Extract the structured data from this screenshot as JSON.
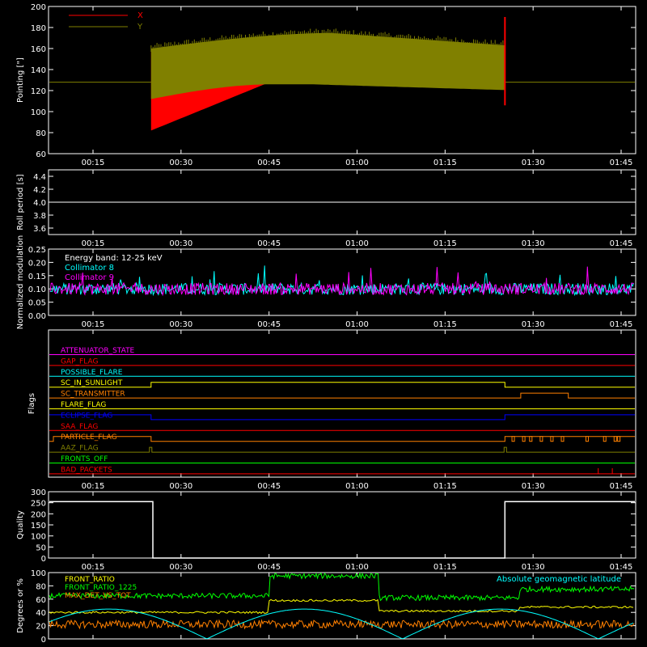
{
  "colors": {
    "axis": "#ffffff",
    "x": "#ff0000",
    "y": "#808000",
    "line_white": "#ffffff",
    "cyan": "#00ffff",
    "magenta": "#ff00ff",
    "green": "#00ff00",
    "yellow": "#ffff00",
    "orange": "#ff8000",
    "blue": "#0000ff",
    "red": "#ff0000",
    "olive": "#808000"
  },
  "time_ticks": [
    "00:15",
    "00:30",
    "00:45",
    "01:00",
    "01:15",
    "01:30",
    "01:45"
  ],
  "chart_data": [
    {
      "type": "line",
      "id": "pointing",
      "ylabel": "Pointing [\"]",
      "ylim": [
        60,
        200
      ],
      "yticks": [
        60,
        80,
        100,
        120,
        140,
        160,
        180,
        200
      ],
      "series": [
        {
          "name": "X",
          "color": "#ff0000",
          "note_range": "envelope ~80-160 during 00:25-01:25, constant 128 outside"
        },
        {
          "name": "Y",
          "color": "#808000",
          "note_range": "envelope ~120-175 during 00:25-01:25, constant 128 outside"
        }
      ],
      "legend": "top-left"
    },
    {
      "type": "line",
      "id": "roll",
      "ylabel": "Roll period [s]",
      "ylim": [
        3.5,
        4.5
      ],
      "yticks": [
        3.6,
        3.8,
        4.0,
        4.2,
        4.4
      ],
      "series": [
        {
          "color": "#ffffff",
          "value": 4.0
        }
      ]
    },
    {
      "type": "line",
      "id": "modulation",
      "ylabel": "Normalized modulation",
      "ylim": [
        0.0,
        0.25
      ],
      "yticks": [
        0.0,
        0.05,
        0.1,
        0.15,
        0.2,
        0.25
      ],
      "annotation": "Energy band: 12-25 keV",
      "series": [
        {
          "name": "Collimator 8",
          "color": "#00ffff",
          "mean": 0.1
        },
        {
          "name": "Collimator 9",
          "color": "#ff00ff",
          "mean": 0.1
        }
      ],
      "legend": "top-left"
    },
    {
      "type": "line",
      "id": "flags",
      "ylabel": "Flags",
      "flags": [
        {
          "name": "ATTENUATOR_STATE",
          "color": "#ff00ff"
        },
        {
          "name": "GAP_FLAG",
          "color": "#ff0000"
        },
        {
          "name": "POSSIBLE_FLARE",
          "color": "#00ffff"
        },
        {
          "name": "SC_IN_SUNLIGHT",
          "color": "#ffff00"
        },
        {
          "name": "SC_TRANSMITTER",
          "color": "#ff8000"
        },
        {
          "name": "FLARE_FLAG",
          "color": "#ffff00"
        },
        {
          "name": "ECLIPSE_FLAG",
          "color": "#0000ff"
        },
        {
          "name": "SAA_FLAG",
          "color": "#ff0000"
        },
        {
          "name": "PARTICLE_FLAG",
          "color": "#ff8000"
        },
        {
          "name": "AAZ_FLAG",
          "color": "#808000"
        },
        {
          "name": "FRONTS_OFF",
          "color": "#00ff00"
        },
        {
          "name": "BAD_PACKETS",
          "color": "#ff0000"
        }
      ]
    },
    {
      "type": "line",
      "id": "quality",
      "ylabel": "Quality",
      "ylim": [
        0,
        300
      ],
      "yticks": [
        0,
        50,
        100,
        150,
        200,
        250,
        300
      ],
      "series": [
        {
          "color": "#ffffff",
          "segments": [
            [
              0.1,
              255
            ],
            [
              0.42,
              255
            ],
            [
              0.42,
              0
            ],
            [
              1.42,
              0
            ],
            [
              1.42,
              255
            ],
            [
              1.77,
              255
            ]
          ]
        }
      ]
    },
    {
      "type": "line",
      "id": "ratio",
      "ylabel": "Degrees or %",
      "ylim": [
        0,
        100
      ],
      "yticks": [
        0,
        20,
        40,
        60,
        80,
        100
      ],
      "series": [
        {
          "name": "FRONT_RATIO",
          "color": "#ffff00"
        },
        {
          "name": "FRONT_RATIO_1225",
          "color": "#00ff00"
        },
        {
          "name": "MAX_DET_VS_TOT",
          "color": "#ff8000"
        },
        {
          "name": "Absolute geomagnetic latitude",
          "color": "#00ffff"
        }
      ]
    }
  ]
}
